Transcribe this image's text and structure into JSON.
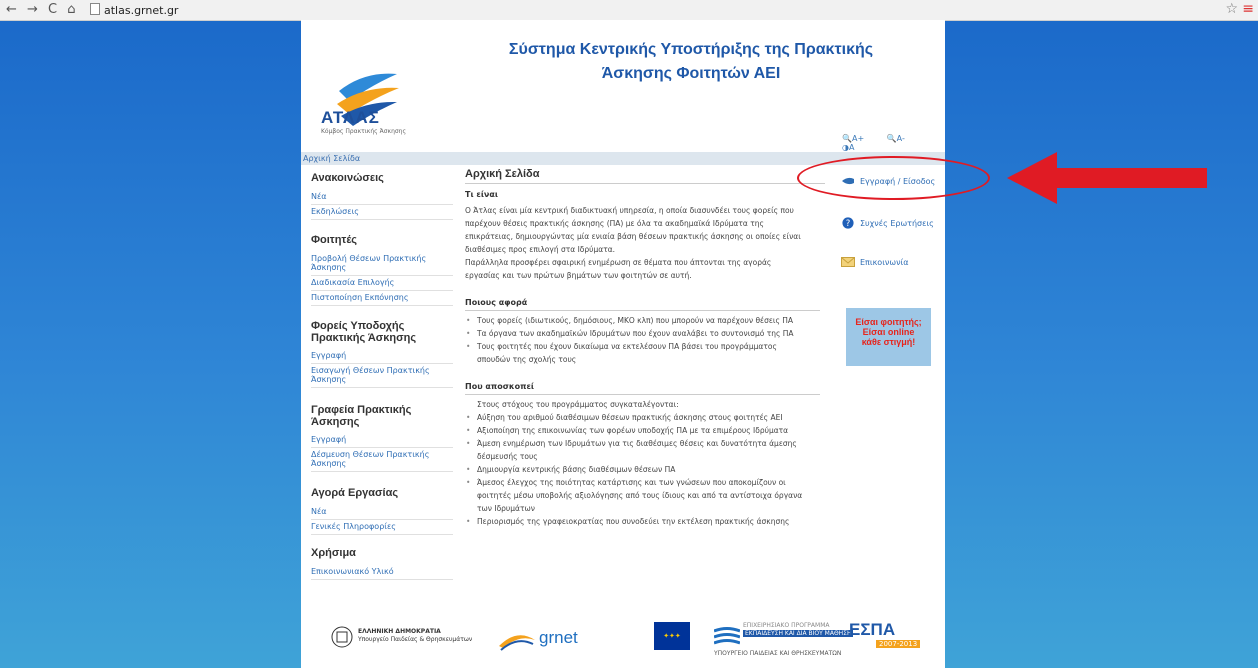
{
  "browser": {
    "url": "atlas.grnet.gr",
    "nav_glyphs": "← → C ⌂"
  },
  "header": {
    "logo_text": "ΑΤΛΑΣ",
    "logo_sub": "Κόμβος Πρακτικής Άσκησης",
    "title_line1": "Σύστημα Κεντρικής Υποστήριξης της Πρακτικής",
    "title_line2": "Άσκησης Φοιτητών ΑΕΙ",
    "font_plus": "A+",
    "font_minus": "A-",
    "contrast": "A"
  },
  "breadcrumb": "Αρχική Σελίδα",
  "sidebar": {
    "announcements": {
      "heading": "Ανακοινώσεις",
      "items": [
        "Νέα",
        "Εκδηλώσεις"
      ]
    },
    "students": {
      "heading": "Φοιτητές",
      "items": [
        "Προβολή Θέσεων Πρακτικής Άσκησης",
        "Διαδικασία Επιλογής",
        "Πιστοποίηση Εκπόνησης"
      ]
    },
    "hosts": {
      "heading": "Φορείς Υποδοχής Πρακτικής Άσκησης",
      "items": [
        "Εγγραφή",
        "Εισαγωγή Θέσεων Πρακτικής Άσκησης"
      ]
    },
    "offices": {
      "heading": "Γραφεία Πρακτικής Άσκησης",
      "items": [
        "Εγγραφή",
        "Δέσμευση Θέσεων Πρακτικής Άσκησης"
      ]
    },
    "market": {
      "heading": "Αγορά Εργασίας",
      "items": [
        "Νέα",
        "Γενικές Πληροφορίες"
      ]
    },
    "useful": {
      "heading": "Χρήσιμα",
      "items": [
        "Επικοινωνιακό Υλικό"
      ]
    }
  },
  "main": {
    "title": "Αρχική Σελίδα",
    "what_title": "Τι είναι",
    "what_lines": [
      "Ο Άτλας είναι μία κεντρική διαδικτυακή υπηρεσία, η οποία διασυνδέει τους φορείς που",
      "παρέχουν θέσεις πρακτικής άσκησης (ΠΑ) με όλα τα ακαδημαϊκά Ιδρύματα της",
      "επικράτειας, δημιουργώντας μία ενιαία βάση θέσεων πρακτικής άσκησης οι οποίες είναι",
      "διαθέσιμες προς επιλογή στα Ιδρύματα.",
      "Παράλληλα προσφέρει σφαιρική ενημέρωση σε θέματα που άπτονται της αγοράς",
      "εργασίας και των πρώτων βημάτων των φοιτητών σε αυτή."
    ],
    "who_title": "Ποιους αφορά",
    "who_bullets": [
      "Τους φορείς (ιδιωτικούς, δημόσιους, ΜΚΟ κλπ) που μπορούν να παρέχουν θέσεις ΠΑ",
      "Τα όργανα των ακαδημαϊκών Ιδρυμάτων που έχουν αναλάβει το συντονισμό της ΠΑ",
      "Τους φοιτητές που έχουν δικαίωμα να εκτελέσουν ΠΑ βάσει του προγράμματος",
      "σπουδών της σχολής τους"
    ],
    "goal_title": "Που αποσκοπεί",
    "goal_intro": "Στους στόχους του προγράμματος συγκαταλέγονται:",
    "goal_bullets": [
      "Αύξηση του αριθμού διαθέσιμων θέσεων πρακτικής άσκησης στους φοιτητές ΑΕΙ",
      "Αξιοποίηση της επικοινωνίας των φορέων υποδοχής ΠΑ με τα επιμέρους Ιδρύματα",
      "Άμεση ενημέρωση των Ιδρυμάτων για τις διαθέσιμες θέσεις και δυνατότητα άμεσης",
      "δέσμευσής τους",
      "Δημιουργία κεντρικής βάσης διαθέσιμων θέσεων ΠΑ",
      "Άμεσος έλεγχος της ποιότητας κατάρτισης και των γνώσεων που αποκομίζουν οι",
      "φοιτητές μέσω υποβολής αξιολόγησης από τους ίδιους και από τα αντίστοιχα όργανα",
      "των Ιδρυμάτων",
      "Περιορισμός της γραφειοκρατίας που συνοδεύει την εκτέλεση πρακτικής άσκησης"
    ]
  },
  "right": {
    "login": "Εγγραφή / Είσοδος",
    "faq": "Συχνές Ερωτήσεις",
    "contact": "Επικοινωνία",
    "promo_line1": "Είσαι φοιτητής;",
    "promo_line2": "Είσαι online",
    "promo_line3": "κάθε στιγμή!"
  },
  "footer": {
    "gov1": "ΕΛΛΗΝΙΚΗ ΔΗΜΟΚΡΑΤΙΑ",
    "gov2": "Υπουργείο Παιδείας & Θρησκευμάτων",
    "grnet": "grnet",
    "op1": "ΕΠΙΧΕΙΡΗΣΙΑΚΟ ΠΡΟΓΡΑΜΜΑ",
    "op2": "ΕΚΠΑΙΔΕΥΣΗ ΚΑΙ ΔΙΑ ΒΙΟΥ ΜΑΘΗΣΗ",
    "op3": "ΥΠΟΥΡΓΕΙΟ ΠΑΙΔΕΙΑΣ ΚΑΙ ΘΡΗΣΚΕΥΜΑΤΩΝ",
    "espa": "ΕΣΠΑ",
    "espa_years": "2007-2013"
  },
  "colors": {
    "accent": "#1f58a8",
    "link": "#2e6db4",
    "annotation": "#e01b24"
  }
}
